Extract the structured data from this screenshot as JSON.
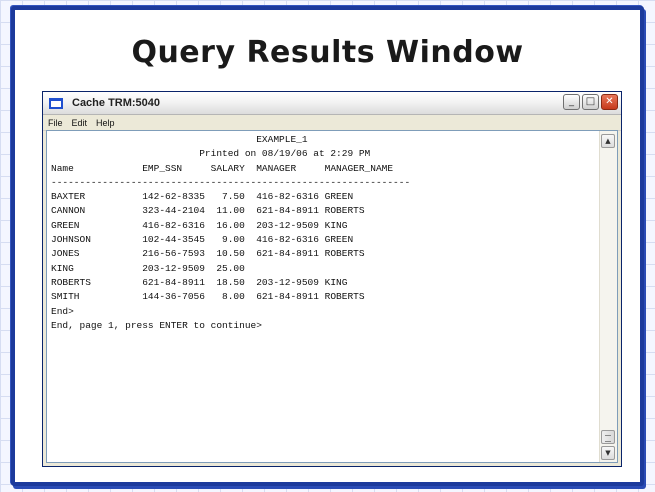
{
  "slide": {
    "title": "Query Results Window"
  },
  "window": {
    "title": "Cache TRM:5040",
    "controls": {
      "minimize": "_",
      "maximize": "□",
      "close": "✕"
    }
  },
  "menubar": {
    "items": [
      "File",
      "Edit",
      "Help"
    ]
  },
  "terminal": {
    "report_name": "EXAMPLE_1",
    "printed_line": "Printed on 08/19/06 at 2:29 PM",
    "columns": [
      "Name",
      "EMP_SSN",
      "SALARY",
      "MANAGER",
      "MANAGER_NAME"
    ],
    "rows": [
      [
        "BAXTER",
        "142-62-8335",
        "7.50",
        "416-82-6316",
        "GREEN"
      ],
      [
        "CANNON",
        "323-44-2104",
        "11.00",
        "621-84-8911",
        "ROBERTS"
      ],
      [
        "GREEN",
        "416-82-6316",
        "16.00",
        "203-12-9509",
        "KING"
      ],
      [
        "JOHNSON",
        "102-44-3545",
        "9.00",
        "416-82-6316",
        "GREEN"
      ],
      [
        "JONES",
        "216-56-7593",
        "10.50",
        "621-84-8911",
        "ROBERTS"
      ],
      [
        "KING",
        "203-12-9509",
        "25.00",
        "",
        ""
      ],
      [
        "ROBERTS",
        "621-84-8911",
        "18.50",
        "203-12-9509",
        "KING"
      ],
      [
        "SMITH",
        "144-36-7056",
        "8.00",
        "621-84-8911",
        "ROBERTS"
      ]
    ],
    "end_prompt": "End>",
    "footer_prompt": "End, page 1, press ENTER to continue>"
  },
  "icons": {
    "window_icon": "window-icon",
    "scroll_up": "chevron-up-icon",
    "scroll_down": "chevron-down-icon"
  }
}
